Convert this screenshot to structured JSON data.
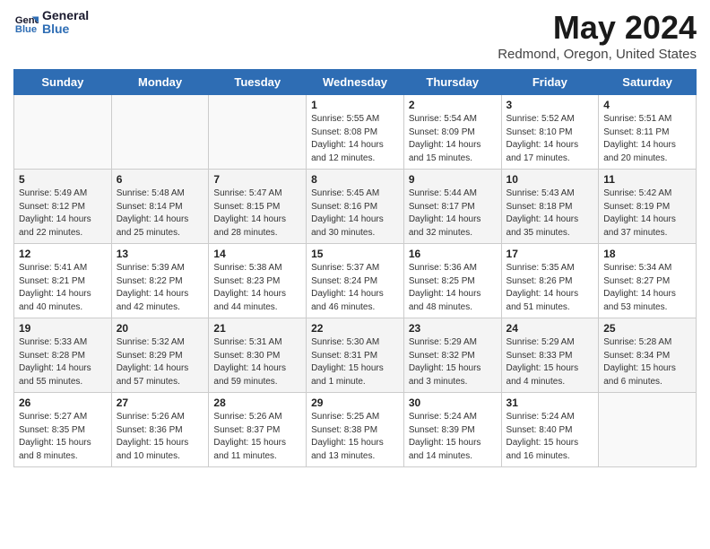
{
  "header": {
    "logo_line1": "General",
    "logo_line2": "Blue",
    "title": "May 2024",
    "subtitle": "Redmond, Oregon, United States"
  },
  "days_of_week": [
    "Sunday",
    "Monday",
    "Tuesday",
    "Wednesday",
    "Thursday",
    "Friday",
    "Saturday"
  ],
  "weeks": [
    [
      {
        "day": "",
        "sunrise": "",
        "sunset": "",
        "daylight": ""
      },
      {
        "day": "",
        "sunrise": "",
        "sunset": "",
        "daylight": ""
      },
      {
        "day": "",
        "sunrise": "",
        "sunset": "",
        "daylight": ""
      },
      {
        "day": "1",
        "sunrise": "Sunrise: 5:55 AM",
        "sunset": "Sunset: 8:08 PM",
        "daylight": "Daylight: 14 hours and 12 minutes."
      },
      {
        "day": "2",
        "sunrise": "Sunrise: 5:54 AM",
        "sunset": "Sunset: 8:09 PM",
        "daylight": "Daylight: 14 hours and 15 minutes."
      },
      {
        "day": "3",
        "sunrise": "Sunrise: 5:52 AM",
        "sunset": "Sunset: 8:10 PM",
        "daylight": "Daylight: 14 hours and 17 minutes."
      },
      {
        "day": "4",
        "sunrise": "Sunrise: 5:51 AM",
        "sunset": "Sunset: 8:11 PM",
        "daylight": "Daylight: 14 hours and 20 minutes."
      }
    ],
    [
      {
        "day": "5",
        "sunrise": "Sunrise: 5:49 AM",
        "sunset": "Sunset: 8:12 PM",
        "daylight": "Daylight: 14 hours and 22 minutes."
      },
      {
        "day": "6",
        "sunrise": "Sunrise: 5:48 AM",
        "sunset": "Sunset: 8:14 PM",
        "daylight": "Daylight: 14 hours and 25 minutes."
      },
      {
        "day": "7",
        "sunrise": "Sunrise: 5:47 AM",
        "sunset": "Sunset: 8:15 PM",
        "daylight": "Daylight: 14 hours and 28 minutes."
      },
      {
        "day": "8",
        "sunrise": "Sunrise: 5:45 AM",
        "sunset": "Sunset: 8:16 PM",
        "daylight": "Daylight: 14 hours and 30 minutes."
      },
      {
        "day": "9",
        "sunrise": "Sunrise: 5:44 AM",
        "sunset": "Sunset: 8:17 PM",
        "daylight": "Daylight: 14 hours and 32 minutes."
      },
      {
        "day": "10",
        "sunrise": "Sunrise: 5:43 AM",
        "sunset": "Sunset: 8:18 PM",
        "daylight": "Daylight: 14 hours and 35 minutes."
      },
      {
        "day": "11",
        "sunrise": "Sunrise: 5:42 AM",
        "sunset": "Sunset: 8:19 PM",
        "daylight": "Daylight: 14 hours and 37 minutes."
      }
    ],
    [
      {
        "day": "12",
        "sunrise": "Sunrise: 5:41 AM",
        "sunset": "Sunset: 8:21 PM",
        "daylight": "Daylight: 14 hours and 40 minutes."
      },
      {
        "day": "13",
        "sunrise": "Sunrise: 5:39 AM",
        "sunset": "Sunset: 8:22 PM",
        "daylight": "Daylight: 14 hours and 42 minutes."
      },
      {
        "day": "14",
        "sunrise": "Sunrise: 5:38 AM",
        "sunset": "Sunset: 8:23 PM",
        "daylight": "Daylight: 14 hours and 44 minutes."
      },
      {
        "day": "15",
        "sunrise": "Sunrise: 5:37 AM",
        "sunset": "Sunset: 8:24 PM",
        "daylight": "Daylight: 14 hours and 46 minutes."
      },
      {
        "day": "16",
        "sunrise": "Sunrise: 5:36 AM",
        "sunset": "Sunset: 8:25 PM",
        "daylight": "Daylight: 14 hours and 48 minutes."
      },
      {
        "day": "17",
        "sunrise": "Sunrise: 5:35 AM",
        "sunset": "Sunset: 8:26 PM",
        "daylight": "Daylight: 14 hours and 51 minutes."
      },
      {
        "day": "18",
        "sunrise": "Sunrise: 5:34 AM",
        "sunset": "Sunset: 8:27 PM",
        "daylight": "Daylight: 14 hours and 53 minutes."
      }
    ],
    [
      {
        "day": "19",
        "sunrise": "Sunrise: 5:33 AM",
        "sunset": "Sunset: 8:28 PM",
        "daylight": "Daylight: 14 hours and 55 minutes."
      },
      {
        "day": "20",
        "sunrise": "Sunrise: 5:32 AM",
        "sunset": "Sunset: 8:29 PM",
        "daylight": "Daylight: 14 hours and 57 minutes."
      },
      {
        "day": "21",
        "sunrise": "Sunrise: 5:31 AM",
        "sunset": "Sunset: 8:30 PM",
        "daylight": "Daylight: 14 hours and 59 minutes."
      },
      {
        "day": "22",
        "sunrise": "Sunrise: 5:30 AM",
        "sunset": "Sunset: 8:31 PM",
        "daylight": "Daylight: 15 hours and 1 minute."
      },
      {
        "day": "23",
        "sunrise": "Sunrise: 5:29 AM",
        "sunset": "Sunset: 8:32 PM",
        "daylight": "Daylight: 15 hours and 3 minutes."
      },
      {
        "day": "24",
        "sunrise": "Sunrise: 5:29 AM",
        "sunset": "Sunset: 8:33 PM",
        "daylight": "Daylight: 15 hours and 4 minutes."
      },
      {
        "day": "25",
        "sunrise": "Sunrise: 5:28 AM",
        "sunset": "Sunset: 8:34 PM",
        "daylight": "Daylight: 15 hours and 6 minutes."
      }
    ],
    [
      {
        "day": "26",
        "sunrise": "Sunrise: 5:27 AM",
        "sunset": "Sunset: 8:35 PM",
        "daylight": "Daylight: 15 hours and 8 minutes."
      },
      {
        "day": "27",
        "sunrise": "Sunrise: 5:26 AM",
        "sunset": "Sunset: 8:36 PM",
        "daylight": "Daylight: 15 hours and 10 minutes."
      },
      {
        "day": "28",
        "sunrise": "Sunrise: 5:26 AM",
        "sunset": "Sunset: 8:37 PM",
        "daylight": "Daylight: 15 hours and 11 minutes."
      },
      {
        "day": "29",
        "sunrise": "Sunrise: 5:25 AM",
        "sunset": "Sunset: 8:38 PM",
        "daylight": "Daylight: 15 hours and 13 minutes."
      },
      {
        "day": "30",
        "sunrise": "Sunrise: 5:24 AM",
        "sunset": "Sunset: 8:39 PM",
        "daylight": "Daylight: 15 hours and 14 minutes."
      },
      {
        "day": "31",
        "sunrise": "Sunrise: 5:24 AM",
        "sunset": "Sunset: 8:40 PM",
        "daylight": "Daylight: 15 hours and 16 minutes."
      },
      {
        "day": "",
        "sunrise": "",
        "sunset": "",
        "daylight": ""
      }
    ]
  ]
}
